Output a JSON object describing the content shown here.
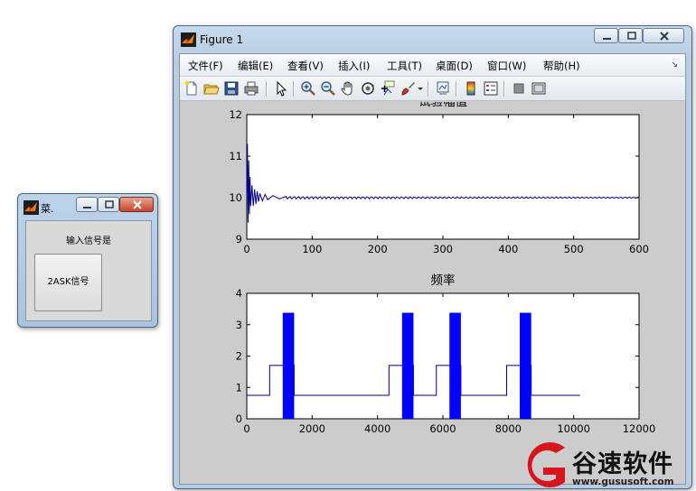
{
  "menu_window": {
    "title": "菜.",
    "prompt": "输入信号是",
    "button_label": "2ASK信号"
  },
  "figure_window": {
    "title": "Figure 1",
    "menu": [
      "文件(F)",
      "编辑(E)",
      "查看(V)",
      "插入(I)",
      "工具(T)",
      "桌面(D)",
      "窗口(W)",
      "帮助(H)"
    ],
    "toolbar": [
      "new-file-icon",
      "open-folder-icon",
      "save-icon",
      "print-icon",
      "pointer-icon",
      "zoom-in-icon",
      "zoom-out-icon",
      "pan-hand-icon",
      "rotate-3d-icon",
      "data-cursor-icon",
      "brush-icon",
      "brush-dropdown-icon",
      "link-plot-icon",
      "colorbar-icon",
      "legend-icon",
      "hide-plot-tools-icon",
      "show-plot-tools-icon"
    ]
  },
  "watermark": {
    "brand": "谷速软件",
    "url": "www.gususoft.com"
  },
  "chart_data": [
    {
      "type": "line",
      "title": "试验幅值",
      "xlim": [
        0,
        600
      ],
      "ylim": [
        9,
        12
      ],
      "xticks": [
        "0",
        "100",
        "200",
        "300",
        "400",
        "500",
        "600"
      ],
      "yticks": [
        "9",
        "10",
        "11",
        "12"
      ],
      "series": [
        {
          "color": "#000080",
          "description": "damped oscillation settling to 10",
          "x": [
            0,
            1,
            2,
            3,
            4,
            5,
            6,
            8,
            10,
            12,
            14,
            16,
            18,
            20,
            24,
            28,
            32,
            40,
            50,
            60,
            80,
            100,
            150,
            200,
            300,
            400,
            500,
            600
          ],
          "y": [
            10,
            11.3,
            9.4,
            10.9,
            9.6,
            10.5,
            9.8,
            10.3,
            9.8,
            10.2,
            9.85,
            10.15,
            9.9,
            10.1,
            9.92,
            10.08,
            9.95,
            10.05,
            9.97,
            10.03,
            9.98,
            10.02,
            10,
            10,
            10,
            10,
            10,
            10
          ]
        }
      ]
    },
    {
      "type": "line",
      "title": "频率",
      "xlim": [
        0,
        12000
      ],
      "ylim": [
        0,
        4
      ],
      "xticks": [
        "0",
        "2000",
        "4000",
        "6000",
        "8000",
        "10000",
        "12000"
      ],
      "yticks": [
        "0",
        "1",
        "2",
        "3",
        "4"
      ],
      "series": [
        {
          "color": "#000080",
          "baseline": 0.75,
          "step_level": 1.7,
          "burst_level": 3.38,
          "segments": [
            {
              "step_start": 700,
              "burst_start": 1100,
              "burst_end": 1450
            },
            {
              "step_start": 4350,
              "burst_start": 4750,
              "burst_end": 5100
            },
            {
              "step_start": 5800,
              "burst_start": 6200,
              "burst_end": 6550
            },
            {
              "step_start": 7950,
              "burst_start": 8350,
              "burst_end": 8700
            }
          ],
          "x_end": 10200
        }
      ]
    }
  ]
}
